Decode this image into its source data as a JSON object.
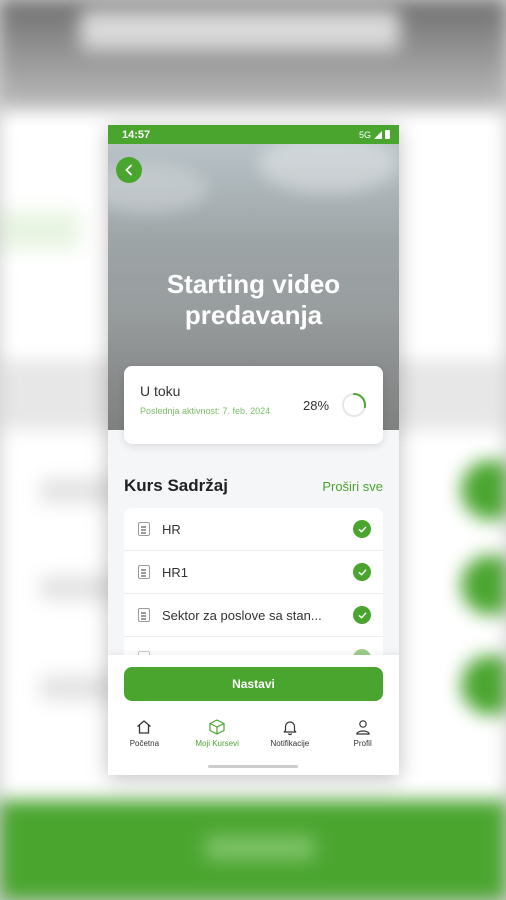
{
  "status_bar": {
    "time": "14:57",
    "network": "5G"
  },
  "course": {
    "title": "Starting video predavanja"
  },
  "progress": {
    "status": "U toku",
    "last_activity": "Poslednja aktivnost: 7. feb. 2024",
    "percent_label": "28%",
    "percent": 28
  },
  "content": {
    "heading": "Kurs Sadržaj",
    "expand_label": "Proširi sve",
    "lessons": [
      {
        "title": "HR",
        "completed": true
      },
      {
        "title": "HR1",
        "completed": true
      },
      {
        "title": "Sektor za poslove sa stan...",
        "completed": true
      },
      {
        "title": "",
        "completed": true
      }
    ]
  },
  "cta": {
    "label": "Nastavi"
  },
  "tabs": [
    {
      "label": "Početna",
      "icon": "home-icon",
      "active": false
    },
    {
      "label": "Moji Kursevi",
      "icon": "box-icon",
      "active": true
    },
    {
      "label": "Notifikacije",
      "icon": "bell-icon",
      "active": false
    },
    {
      "label": "Profil",
      "icon": "person-icon",
      "active": false
    }
  ],
  "colors": {
    "accent": "#4aa52f",
    "accent_light": "#7bbf66",
    "background": "#f5f6f8"
  }
}
